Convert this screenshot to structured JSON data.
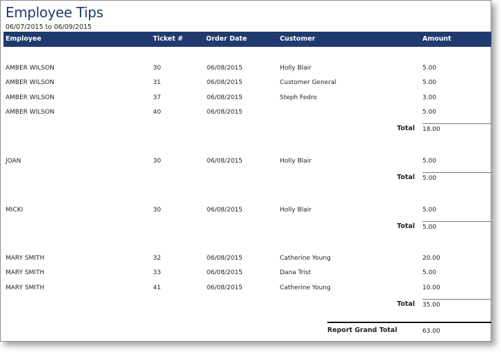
{
  "report": {
    "title": "Employee Tips",
    "date_range": "06/07/2015 to 06/09/2015"
  },
  "columns": {
    "employee": "Employee",
    "ticket": "Ticket #",
    "order_date": "Order Date",
    "customer": "Customer",
    "amount": "Amount"
  },
  "groups": [
    {
      "rows": [
        {
          "employee": "AMBER WILSON",
          "ticket": "30",
          "order_date": "06/08/2015",
          "customer": "Holly Blair",
          "amount": "5.00"
        },
        {
          "employee": "AMBER WILSON",
          "ticket": "31",
          "order_date": "06/08/2015",
          "customer": "Customer General",
          "amount": "5.00"
        },
        {
          "employee": "AMBER WILSON",
          "ticket": "37",
          "order_date": "06/08/2015",
          "customer": "Steph Fedro",
          "amount": "3.00"
        },
        {
          "employee": "AMBER WILSON",
          "ticket": "40",
          "order_date": "06/08/2015",
          "customer": "",
          "amount": "5.00"
        }
      ],
      "total_label": "Total",
      "total": "18.00"
    },
    {
      "rows": [
        {
          "employee": "JOAN",
          "ticket": "30",
          "order_date": "06/08/2015",
          "customer": "Holly Blair",
          "amount": "5.00"
        }
      ],
      "total_label": "Total",
      "total": "5.00"
    },
    {
      "rows": [
        {
          "employee": "MICKI",
          "ticket": "30",
          "order_date": "06/08/2015",
          "customer": "Holly Blair",
          "amount": "5.00"
        }
      ],
      "total_label": "Total",
      "total": "5.00"
    },
    {
      "rows": [
        {
          "employee": "MARY SMITH",
          "ticket": "32",
          "order_date": "06/08/2015",
          "customer": "Catherine Young",
          "amount": "20.00"
        },
        {
          "employee": "MARY SMITH",
          "ticket": "33",
          "order_date": "06/08/2015",
          "customer": "Dana Trist",
          "amount": "5.00"
        },
        {
          "employee": "MARY SMITH",
          "ticket": "41",
          "order_date": "06/08/2015",
          "customer": "Catherine Young",
          "amount": "10.00"
        }
      ],
      "total_label": "Total",
      "total": "35.00"
    }
  ],
  "grand_total": {
    "label": "Report Grand Total",
    "value": "63.00"
  }
}
